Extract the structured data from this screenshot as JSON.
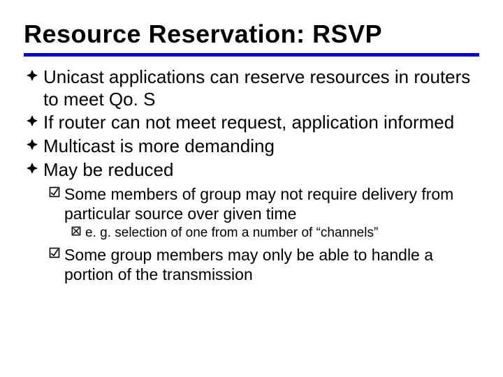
{
  "title": "Resource Reservation: RSVP",
  "bullets": {
    "b1": "Unicast applications can reserve resources in routers to meet Qo. S",
    "b2": "If router can not meet request, application informed",
    "b3": "Multicast is more demanding",
    "b4": "May be reduced",
    "s1": "Some members of group may not require delivery from particular source over given time",
    "s1a": "e. g. selection of one from a number of “channels”",
    "s2": "Some group members may only be able to handle a portion of the transmission"
  }
}
